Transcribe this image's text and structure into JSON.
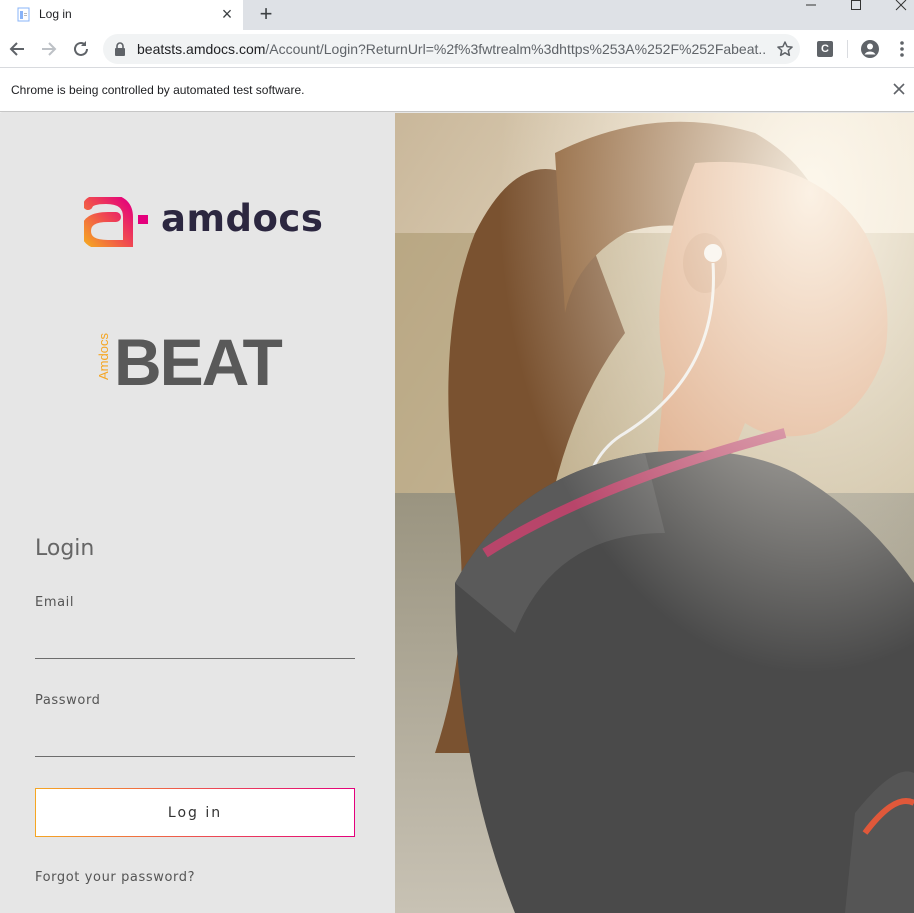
{
  "browser": {
    "tab_title": "Log in",
    "url_host": "beatsts.amdocs.com",
    "url_path": "/Account/Login?ReturnUrl=%2f%3fwtrealm%3dhttps%253A%252F%252Fabeat....",
    "infobar_text": "Chrome is being controlled by automated test software.",
    "extension_letter": "C"
  },
  "logos": {
    "amdocs": "amdocs",
    "beat_vertical": "Amdocs",
    "beat": "BEAT"
  },
  "login": {
    "heading": "Login",
    "email_label": "Email",
    "email_value": "",
    "password_label": "Password",
    "password_value": "",
    "button_label": "Log in",
    "forgot_link": "Forgot your password?"
  },
  "colors": {
    "brand_orange": "#f5a623",
    "brand_pink": "#e4007c",
    "panel_bg": "#e6e6e6"
  },
  "icons": [
    "document-favicon-icon",
    "close-icon",
    "plus-icon",
    "minimize-icon",
    "maximize-icon",
    "window-close-icon",
    "back-icon",
    "forward-icon",
    "reload-icon",
    "lock-icon",
    "star-icon",
    "extension-icon",
    "profile-icon",
    "kebab-menu-icon"
  ]
}
